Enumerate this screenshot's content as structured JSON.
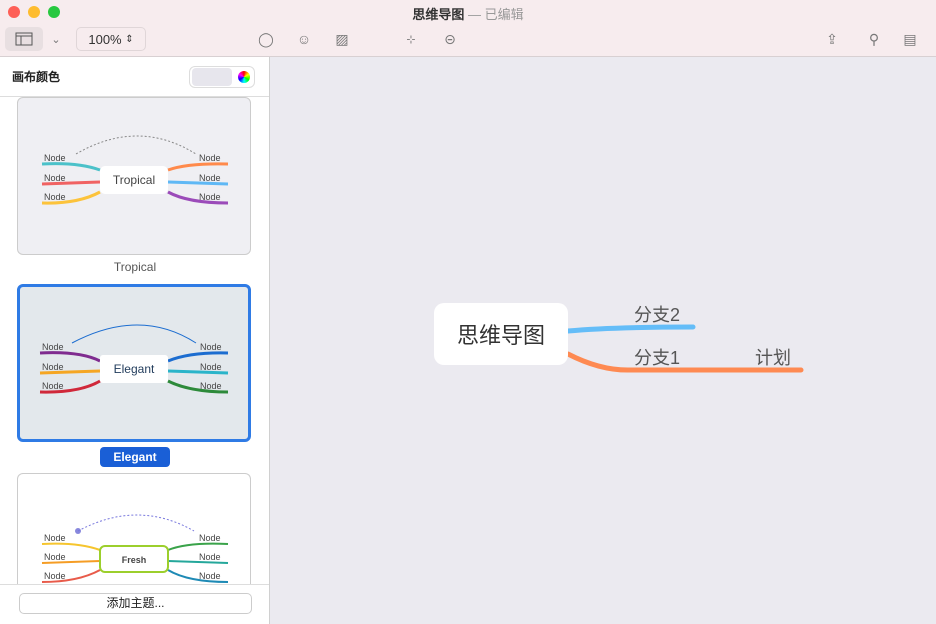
{
  "window": {
    "title": "思维导图",
    "status": "已编辑"
  },
  "toolbar": {
    "zoom": "100%"
  },
  "sidebar": {
    "heading": "画布颜色",
    "add_theme": "添加主题...",
    "themes": [
      {
        "name": "Tropical",
        "center": "Tropical",
        "node": "Node"
      },
      {
        "name": "Elegant",
        "center": "Elegant",
        "node": "Node",
        "selected": true
      },
      {
        "name": "Fresh",
        "center": "Fresh",
        "node": "Node"
      }
    ]
  },
  "map": {
    "root": "思维导图",
    "branches": [
      {
        "label": "分支2",
        "color": "#64bdf8"
      },
      {
        "label": "分支1",
        "color": "#fe8a52",
        "children": [
          {
            "label": "计划"
          }
        ]
      }
    ]
  }
}
